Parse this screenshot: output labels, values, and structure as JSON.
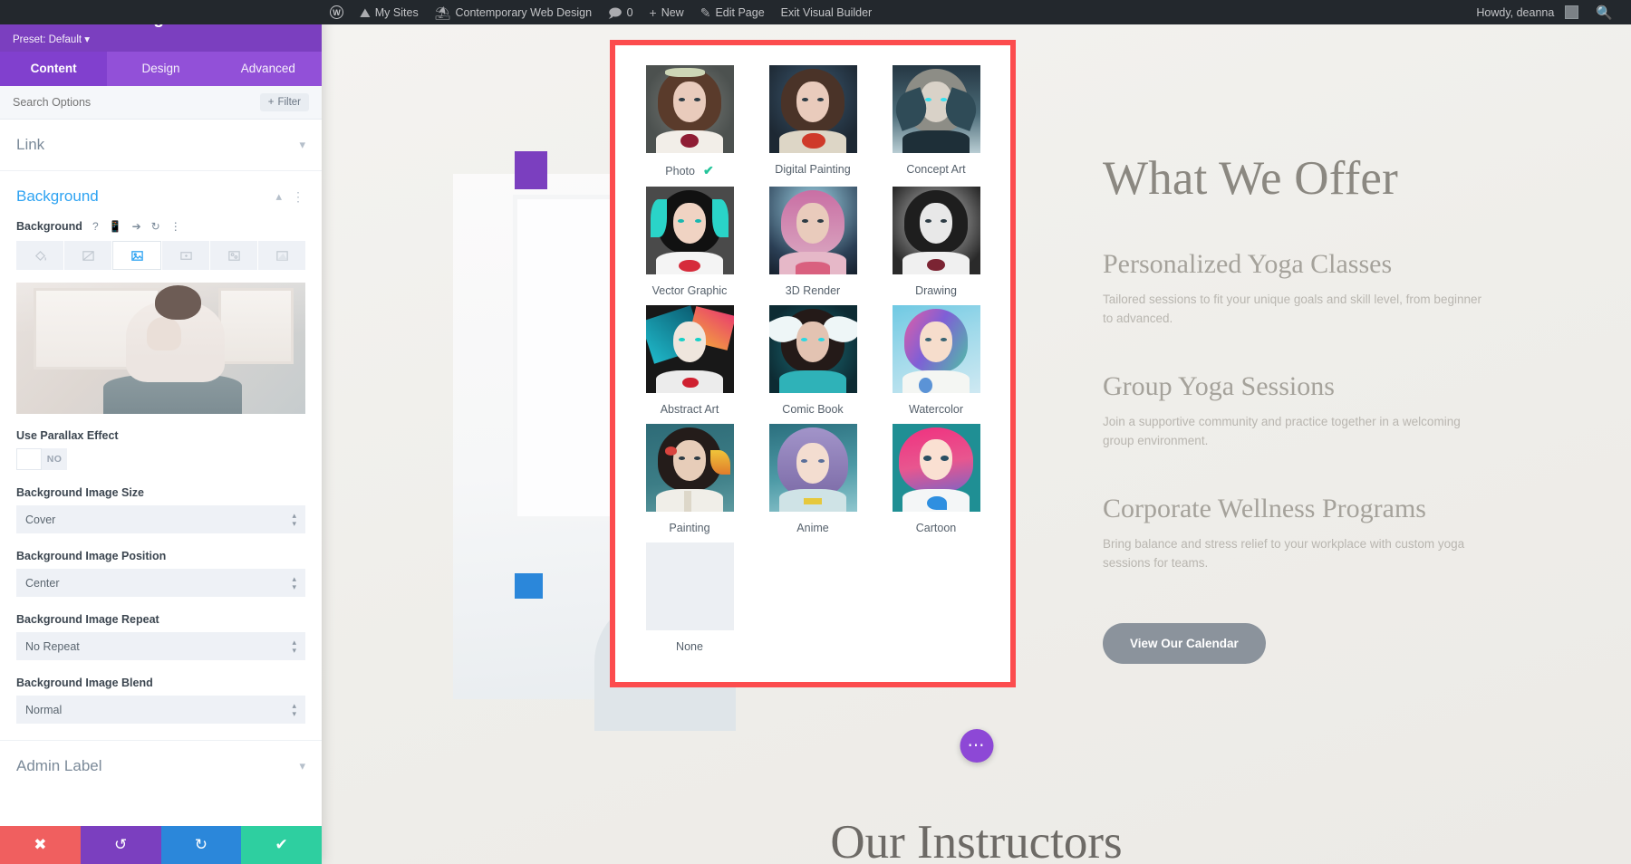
{
  "adminbar": {
    "logo_icon": "wordpress-icon",
    "items": [
      {
        "icon": "sites-icon",
        "label": "My Sites"
      },
      {
        "icon": "site-icon",
        "label": "Contemporary Web Design"
      },
      {
        "icon": "comment-icon",
        "label": "0"
      },
      {
        "icon": "plus-icon",
        "label": "New"
      },
      {
        "icon": "pencil-icon",
        "label": "Edit Page"
      },
      {
        "icon": "",
        "label": "Exit Visual Builder"
      }
    ],
    "howdy": "Howdy, deanna",
    "search_icon": "search-icon"
  },
  "panel": {
    "back_icon": "back-arrow-icon",
    "title": "Column Settings",
    "preset": "Preset: Default",
    "header_icons": [
      "focus-icon",
      "layout-icon"
    ],
    "tabs": [
      {
        "label": "Content",
        "active": true
      },
      {
        "label": "Design",
        "active": false
      },
      {
        "label": "Advanced",
        "active": false
      }
    ],
    "search_placeholder": "Search Options",
    "filter_label": "Filter",
    "filter_icon": "plus-icon",
    "sections": {
      "link": {
        "title": "Link",
        "caret": "chevron-down-icon"
      },
      "background": {
        "title": "Background",
        "caret": "chevron-up-icon",
        "dots": "kebab-icon",
        "control_label": "Background",
        "control_icons": [
          "help-icon",
          "mobile-icon",
          "hover-icon",
          "reset-icon",
          "kebab-icon"
        ],
        "types": [
          {
            "name": "background-color-icon",
            "selected": false
          },
          {
            "name": "background-gradient-icon",
            "selected": false
          },
          {
            "name": "background-image-icon",
            "selected": true
          },
          {
            "name": "background-video-icon",
            "selected": false
          },
          {
            "name": "background-pattern-icon",
            "selected": false
          },
          {
            "name": "background-mask-icon",
            "selected": false
          }
        ],
        "preview_alt": "yoga-background-image-preview"
      },
      "admin_label": {
        "title": "Admin Label",
        "caret": "chevron-down-icon"
      }
    },
    "fields": [
      {
        "label": "Use Parallax Effect",
        "type": "toggle",
        "value": "NO"
      },
      {
        "label": "Background Image Size",
        "type": "select",
        "value": "Cover"
      },
      {
        "label": "Background Image Position",
        "type": "select",
        "value": "Center"
      },
      {
        "label": "Background Image Repeat",
        "type": "select",
        "value": "No Repeat"
      },
      {
        "label": "Background Image Blend",
        "type": "select",
        "value": "Normal"
      }
    ],
    "footer": [
      {
        "name": "cancel-button",
        "icon": "close-icon",
        "color": "#f05f5f"
      },
      {
        "name": "undo-button",
        "icon": "undo-icon",
        "color": "#7b3fbf"
      },
      {
        "name": "redo-button",
        "icon": "redo-icon",
        "color": "#2b87da"
      },
      {
        "name": "save-button",
        "icon": "check-icon",
        "color": "#2ecfa0"
      }
    ]
  },
  "style_modal": {
    "border_color": "#fc4c4e",
    "options": [
      {
        "label": "Photo",
        "selected": true
      },
      {
        "label": "Digital Painting",
        "selected": false
      },
      {
        "label": "Concept Art",
        "selected": false
      },
      {
        "label": "Vector Graphic",
        "selected": false
      },
      {
        "label": "3D Render",
        "selected": false
      },
      {
        "label": "Drawing",
        "selected": false
      },
      {
        "label": "Abstract Art",
        "selected": false
      },
      {
        "label": "Comic Book",
        "selected": false
      },
      {
        "label": "Watercolor",
        "selected": false
      },
      {
        "label": "Painting",
        "selected": false
      },
      {
        "label": "Anime",
        "selected": false
      },
      {
        "label": "Cartoon",
        "selected": false
      },
      {
        "label": "None",
        "selected": false
      }
    ],
    "check_icon": "check-icon"
  },
  "page": {
    "heading": "What We Offer",
    "services": [
      {
        "title": "Personalized Yoga Classes",
        "text": "Tailored sessions to fit your unique goals and skill level, from beginner to advanced."
      },
      {
        "title": "Group Yoga Sessions",
        "text": "Join a supportive community and practice together in a welcoming group environment."
      },
      {
        "title": "Corporate Wellness Programs",
        "text": "Bring balance and stress relief to your workplace with custom yoga sessions for teams."
      }
    ],
    "cta_label": "View Our Calendar",
    "next_section_heading": "Our Instructors",
    "fab_icon": "ellipsis-icon",
    "fab_color": "#8d48d6"
  }
}
